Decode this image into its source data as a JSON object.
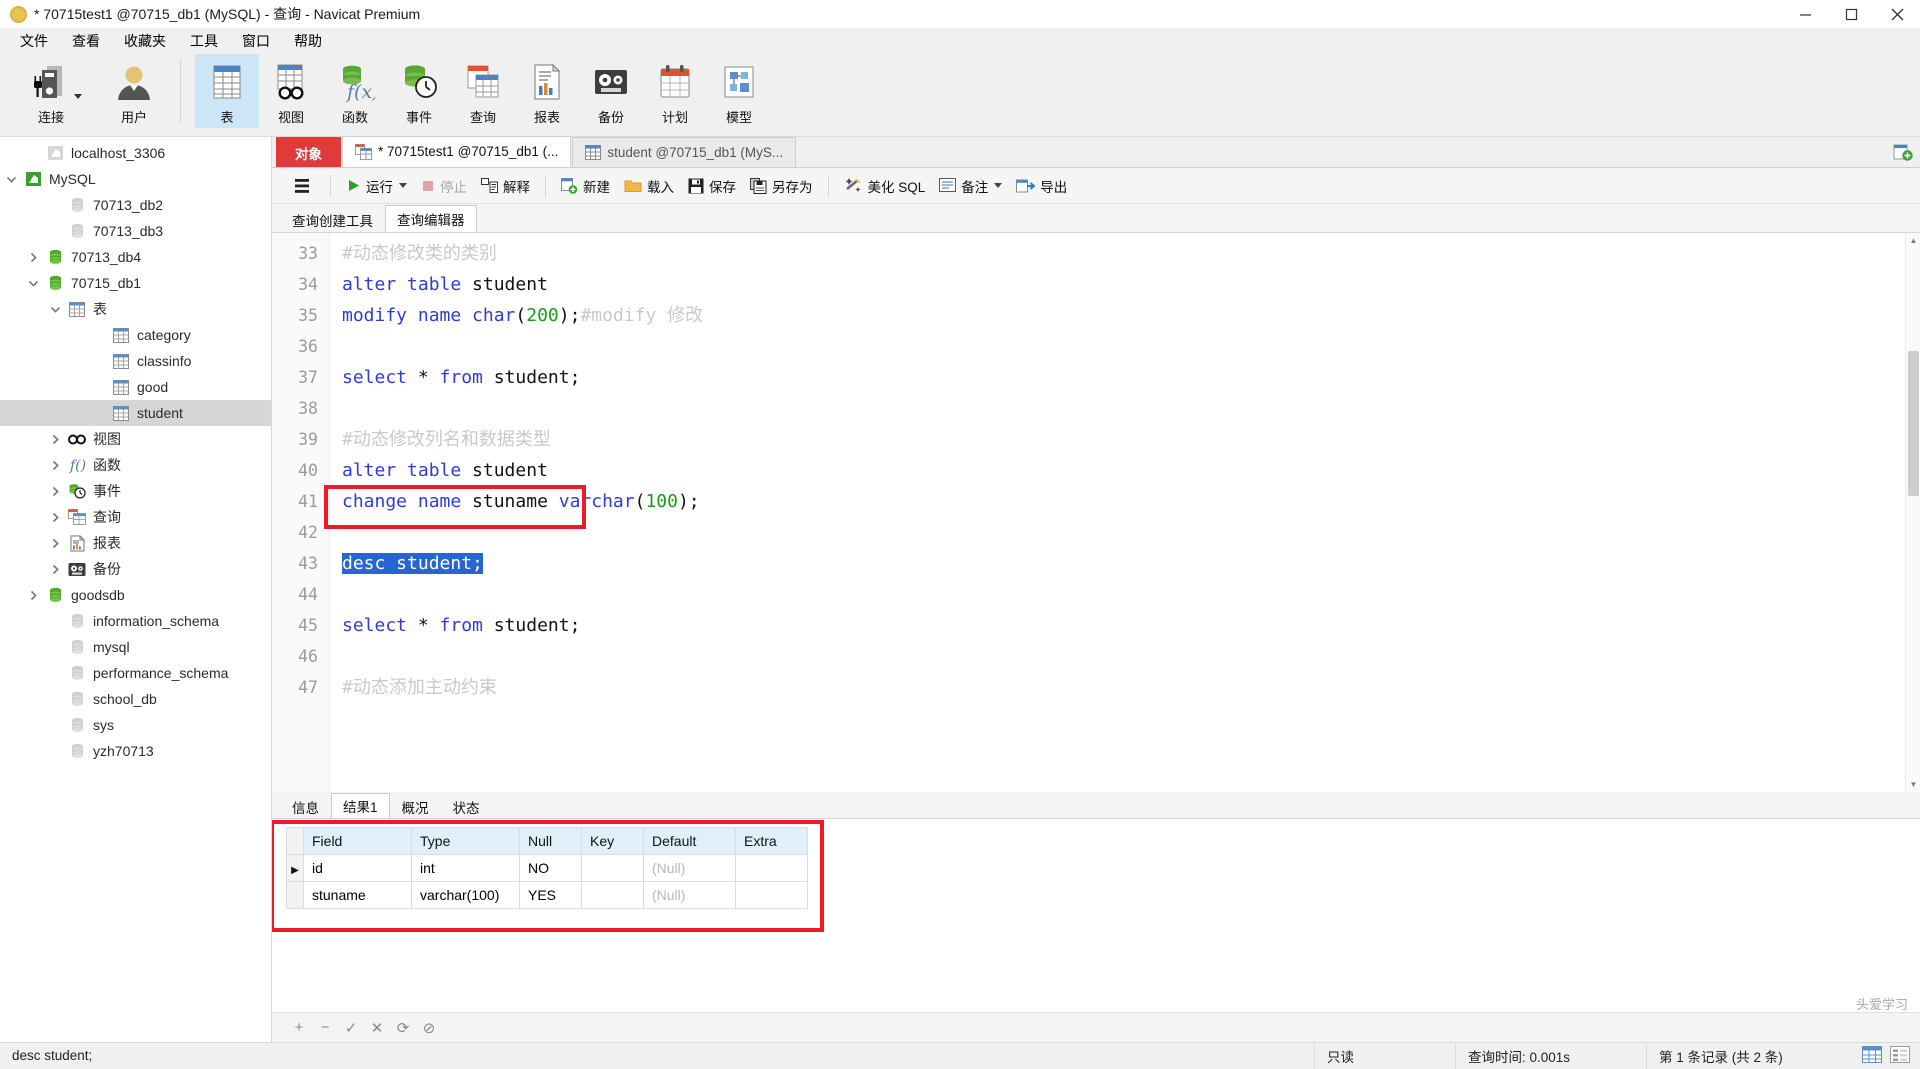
{
  "window": {
    "title": "* 70715test1 @70715_db1 (MySQL) - 查询 - Navicat Premium",
    "minimize": "—",
    "maximize": "❐",
    "close": "✕"
  },
  "menubar": {
    "items": [
      "文件",
      "查看",
      "收藏夹",
      "工具",
      "窗口",
      "帮助"
    ]
  },
  "ribbon": {
    "groups": [
      {
        "buttons": [
          {
            "label": "连接",
            "icon": "connection-icon",
            "has_dropdown": true,
            "active": false
          },
          {
            "label": "用户",
            "icon": "user-icon",
            "has_dropdown": false,
            "active": false
          }
        ]
      },
      {
        "buttons": [
          {
            "label": "表",
            "icon": "table-icon",
            "has_dropdown": false,
            "active": true
          },
          {
            "label": "视图",
            "icon": "view-icon",
            "has_dropdown": false,
            "active": false
          },
          {
            "label": "函数",
            "icon": "function-icon",
            "has_dropdown": false,
            "active": false
          },
          {
            "label": "事件",
            "icon": "event-icon",
            "has_dropdown": false,
            "active": false
          },
          {
            "label": "查询",
            "icon": "query-icon",
            "has_dropdown": false,
            "active": false
          },
          {
            "label": "报表",
            "icon": "report-icon",
            "has_dropdown": false,
            "active": false
          },
          {
            "label": "备份",
            "icon": "backup-icon",
            "has_dropdown": false,
            "active": false
          },
          {
            "label": "计划",
            "icon": "schedule-icon",
            "has_dropdown": false,
            "active": false
          },
          {
            "label": "模型",
            "icon": "model-icon",
            "has_dropdown": false,
            "active": false
          }
        ]
      }
    ]
  },
  "sidebar": {
    "nodes": [
      {
        "label": "localhost_3306",
        "indent": 1,
        "twisty": "none",
        "icon": "connection-grey-icon",
        "selected": false
      },
      {
        "label": "MySQL",
        "indent": 0,
        "twisty": "expanded",
        "icon": "connection-green-icon",
        "selected": false
      },
      {
        "label": "70713_db2",
        "indent": 2,
        "twisty": "none",
        "icon": "db-grey-icon",
        "selected": false
      },
      {
        "label": "70713_db3",
        "indent": 2,
        "twisty": "none",
        "icon": "db-grey-icon",
        "selected": false
      },
      {
        "label": "70713_db4",
        "indent": 1,
        "twisty": "collapsed",
        "icon": "db-green-icon",
        "selected": false
      },
      {
        "label": "70715_db1",
        "indent": 1,
        "twisty": "expanded",
        "icon": "db-green-icon",
        "selected": false
      },
      {
        "label": "表",
        "indent": 2,
        "twisty": "expanded",
        "icon": "table-folder-icon",
        "selected": false
      },
      {
        "label": "category",
        "indent": 4,
        "twisty": "none",
        "icon": "table-icon",
        "selected": false
      },
      {
        "label": "classinfo",
        "indent": 4,
        "twisty": "none",
        "icon": "table-icon",
        "selected": false
      },
      {
        "label": "good",
        "indent": 4,
        "twisty": "none",
        "icon": "table-icon",
        "selected": false
      },
      {
        "label": "student",
        "indent": 4,
        "twisty": "none",
        "icon": "table-icon",
        "selected": true
      },
      {
        "label": "视图",
        "indent": 2,
        "twisty": "collapsed",
        "icon": "view-icon",
        "selected": false
      },
      {
        "label": "函数",
        "indent": 2,
        "twisty": "collapsed",
        "icon": "function-icon",
        "selected": false
      },
      {
        "label": "事件",
        "indent": 2,
        "twisty": "collapsed",
        "icon": "event-icon",
        "selected": false
      },
      {
        "label": "查询",
        "indent": 2,
        "twisty": "collapsed",
        "icon": "query-icon",
        "selected": false
      },
      {
        "label": "报表",
        "indent": 2,
        "twisty": "collapsed",
        "icon": "report-icon",
        "selected": false
      },
      {
        "label": "备份",
        "indent": 2,
        "twisty": "collapsed",
        "icon": "backup-icon",
        "selected": false
      },
      {
        "label": "goodsdb",
        "indent": 1,
        "twisty": "collapsed",
        "icon": "db-green-icon",
        "selected": false
      },
      {
        "label": "information_schema",
        "indent": 2,
        "twisty": "none",
        "icon": "db-grey-icon",
        "selected": false
      },
      {
        "label": "mysql",
        "indent": 2,
        "twisty": "none",
        "icon": "db-grey-icon",
        "selected": false
      },
      {
        "label": "performance_schema",
        "indent": 2,
        "twisty": "none",
        "icon": "db-grey-icon",
        "selected": false
      },
      {
        "label": "school_db",
        "indent": 2,
        "twisty": "none",
        "icon": "db-grey-icon",
        "selected": false
      },
      {
        "label": "sys",
        "indent": 2,
        "twisty": "none",
        "icon": "db-grey-icon",
        "selected": false
      },
      {
        "label": "yzh70713",
        "indent": 2,
        "twisty": "none",
        "icon": "db-grey-icon",
        "selected": false
      }
    ]
  },
  "doctabs": {
    "object_label": "对象",
    "tabs": [
      {
        "label": "* 70715test1 @70715_db1 (...",
        "icon": "query-icon",
        "active": true
      },
      {
        "label": "student @70715_db1 (MyS...",
        "icon": "table-icon",
        "active": false
      }
    ],
    "add_tab_icon": "add-tab-icon"
  },
  "query_toolbar": {
    "menu_icon": "hamburger-icon",
    "buttons": [
      {
        "label": "运行",
        "icon": "play-icon",
        "disabled": false,
        "dropdown": true
      },
      {
        "label": "停止",
        "icon": "stop-icon",
        "disabled": true,
        "dropdown": false
      },
      {
        "label": "解释",
        "icon": "explain-icon",
        "disabled": false,
        "dropdown": false
      },
      {
        "label": "新建",
        "icon": "new-icon",
        "disabled": false,
        "dropdown": false
      },
      {
        "label": "载入",
        "icon": "load-icon",
        "disabled": false,
        "dropdown": false
      },
      {
        "label": "保存",
        "icon": "save-icon",
        "disabled": false,
        "dropdown": false
      },
      {
        "label": "另存为",
        "icon": "saveas-icon",
        "disabled": false,
        "dropdown": false
      },
      {
        "label": "美化 SQL",
        "icon": "beautify-icon",
        "disabled": false,
        "dropdown": false
      },
      {
        "label": "备注",
        "icon": "comment-icon",
        "disabled": false,
        "dropdown": true
      },
      {
        "label": "导出",
        "icon": "export-icon",
        "disabled": false,
        "dropdown": false
      }
    ]
  },
  "editor_tabs": [
    {
      "label": "查询创建工具",
      "active": false
    },
    {
      "label": "查询编辑器",
      "active": true
    }
  ],
  "editor": {
    "first_line_number": 33,
    "lines": [
      {
        "n": 33,
        "tokens": [
          {
            "t": "#动态修改类的类别",
            "c": "c"
          }
        ]
      },
      {
        "n": 34,
        "tokens": [
          {
            "t": "alter table ",
            "c": "k"
          },
          {
            "t": "student",
            "c": "p"
          }
        ]
      },
      {
        "n": 35,
        "tokens": [
          {
            "t": "modify name char",
            "c": "k"
          },
          {
            "t": "(",
            "c": "p"
          },
          {
            "t": "200",
            "c": "n"
          },
          {
            "t": ");",
            "c": "p"
          },
          {
            "t": "#modify 修改",
            "c": "c"
          }
        ]
      },
      {
        "n": 36,
        "tokens": []
      },
      {
        "n": 37,
        "tokens": [
          {
            "t": "select ",
            "c": "k"
          },
          {
            "t": "* ",
            "c": "p"
          },
          {
            "t": "from ",
            "c": "k"
          },
          {
            "t": "student;",
            "c": "p"
          }
        ]
      },
      {
        "n": 38,
        "tokens": []
      },
      {
        "n": 39,
        "tokens": [
          {
            "t": "#动态修改列名和数据类型",
            "c": "c"
          }
        ]
      },
      {
        "n": 40,
        "tokens": [
          {
            "t": "alter table ",
            "c": "k"
          },
          {
            "t": "student",
            "c": "p"
          }
        ]
      },
      {
        "n": 41,
        "tokens": [
          {
            "t": "change name ",
            "c": "k"
          },
          {
            "t": "stuname ",
            "c": "p"
          },
          {
            "t": "varchar",
            "c": "k"
          },
          {
            "t": "(",
            "c": "p"
          },
          {
            "t": "100",
            "c": "n"
          },
          {
            "t": ");",
            "c": "p"
          }
        ]
      },
      {
        "n": 42,
        "tokens": []
      },
      {
        "n": 43,
        "tokens": [
          {
            "t": "desc student;",
            "c": "sel-text"
          }
        ]
      },
      {
        "n": 44,
        "tokens": []
      },
      {
        "n": 45,
        "tokens": [
          {
            "t": "select ",
            "c": "k"
          },
          {
            "t": "* ",
            "c": "p"
          },
          {
            "t": "from ",
            "c": "k"
          },
          {
            "t": "student;",
            "c": "p"
          }
        ]
      },
      {
        "n": 46,
        "tokens": []
      },
      {
        "n": 47,
        "tokens": [
          {
            "t": "#动态添加主动约束",
            "c": "c"
          }
        ]
      }
    ]
  },
  "result_tabs": [
    {
      "label": "信息",
      "active": false
    },
    {
      "label": "结果1",
      "active": true
    },
    {
      "label": "概况",
      "active": false
    },
    {
      "label": "状态",
      "active": false
    }
  ],
  "result_grid": {
    "columns": [
      "Field",
      "Type",
      "Null",
      "Key",
      "Default",
      "Extra"
    ],
    "rows": [
      {
        "current": true,
        "cells": [
          "id",
          "int",
          "NO",
          "",
          "(Null)",
          ""
        ]
      },
      {
        "current": false,
        "cells": [
          "stuname",
          "varchar(100)",
          "YES",
          "",
          "(Null)",
          ""
        ]
      }
    ],
    "null_text": "(Null)"
  },
  "grid_toolbar": {
    "buttons": [
      "add-record-icon",
      "remove-record-icon",
      "apply-icon",
      "cancel-icon",
      "refresh-icon",
      "stop-icon"
    ]
  },
  "statusbar": {
    "sql": "desc student;",
    "readonly": "只读",
    "duration": "查询时间: 0.001s",
    "records": "第 1 条记录 (共 2 条)",
    "watermark": "头爱学习",
    "grid_view_icon": "grid-view-icon",
    "form_view_icon": "form-view-icon"
  },
  "colors": {
    "accent_red": "#e03a3a",
    "highlight_box": "#f0192a",
    "selection_blue": "#2766d0",
    "active_ribbon": "#cde6f7",
    "header_blue": "#dff0fb",
    "green": "#46a513"
  }
}
